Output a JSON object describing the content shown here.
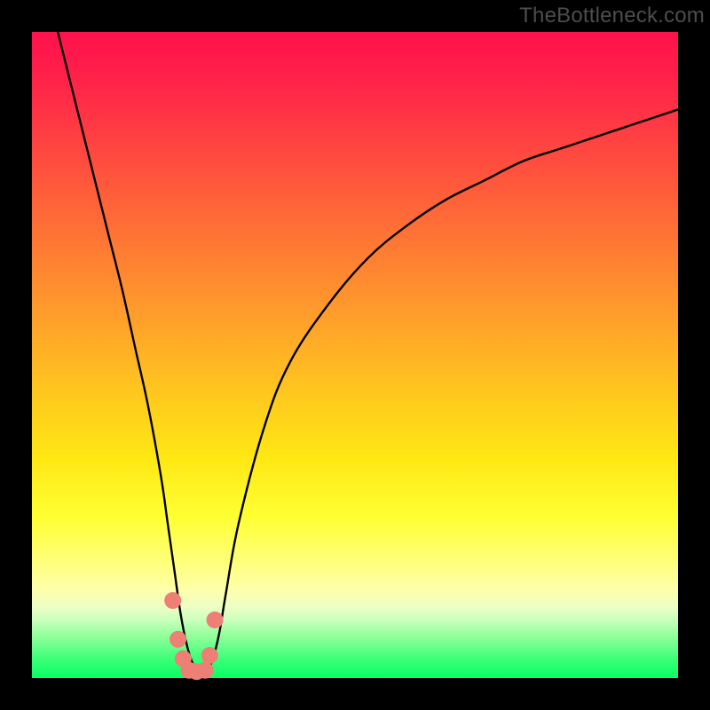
{
  "watermark": "TheBottleneck.com",
  "chart_data": {
    "type": "line",
    "title": "",
    "xlabel": "",
    "ylabel": "",
    "xlim": [
      0,
      100
    ],
    "ylim": [
      0,
      100
    ],
    "grid": false,
    "legend": false,
    "series": [
      {
        "name": "curve",
        "type": "line",
        "color": "#000000",
        "x": [
          4,
          6,
          8,
          10,
          12,
          14,
          16,
          18,
          20,
          21,
          22,
          23,
          24,
          25,
          26,
          27,
          28,
          29,
          30,
          32,
          36,
          40,
          46,
          52,
          58,
          64,
          70,
          76,
          82,
          88,
          94,
          100
        ],
        "y": [
          100,
          92,
          84,
          76,
          68,
          60,
          51,
          42,
          31,
          24,
          17,
          10,
          5,
          2,
          1,
          1,
          3,
          7,
          13,
          24,
          39,
          49,
          58,
          65,
          70,
          74,
          77,
          80,
          82,
          84,
          86,
          88
        ]
      },
      {
        "name": "markers",
        "type": "scatter",
        "color": "#ee7f75",
        "x": [
          21.8,
          22.6,
          23.4,
          24.3,
          25.5,
          26.8,
          27.5,
          28.3
        ],
        "y": [
          12,
          6,
          3,
          1.2,
          1,
          1.2,
          3.5,
          9
        ]
      }
    ],
    "background_gradient": {
      "top": "#ff124c",
      "mid_upper": "#ff9e2b",
      "mid": "#ffe814",
      "mid_lower": "#ffff7a",
      "bottom": "#0bff65"
    }
  }
}
